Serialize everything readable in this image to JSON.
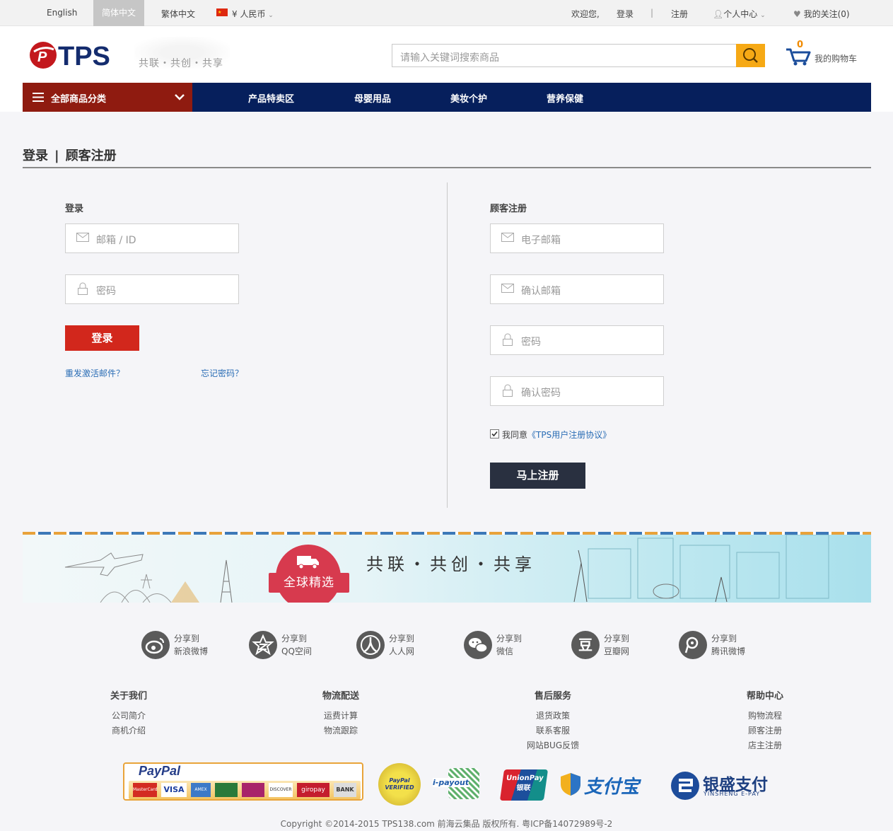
{
  "topbar": {
    "lang_en": "English",
    "lang_sc": "简体中文",
    "lang_tc": "繁体中文",
    "currency": "¥ 人民币",
    "welcome": "欢迎您,",
    "login": "登录",
    "divider": "|",
    "register": "注册",
    "account": "个人中心",
    "favorites": "我的关注(0)"
  },
  "header": {
    "logo": "TPS",
    "slogan": "共联・共创・共享",
    "search_placeholder": "请输入关键词搜索商品",
    "cart_count": "0",
    "cart_label": "我的购物车"
  },
  "nav": {
    "all_categories": "全部商品分类",
    "items": [
      "产品特卖区",
      "母婴用品",
      "美妆个护",
      "营养保健"
    ]
  },
  "page": {
    "title_login": "登录",
    "title_sep": "|",
    "title_register": "顾客注册"
  },
  "login": {
    "heading": "登录",
    "email_placeholder": "邮箱 / ID",
    "password_placeholder": "密码",
    "button": "登录",
    "resend": "重发激活邮件？",
    "forgot": "忘记密码？"
  },
  "register": {
    "heading": "顾客注册",
    "email_placeholder": "电子邮箱",
    "confirm_email_placeholder": "确认邮箱",
    "password_placeholder": "密码",
    "confirm_password_placeholder": "确认密码",
    "agree_prefix": "我同意",
    "agree_link": "《TPS用户注册协议》",
    "button": "马上注册"
  },
  "banner": {
    "badge": "全球精选",
    "slogan": "共联・共创・共享"
  },
  "share": [
    {
      "line1": "分享到",
      "line2": "新浪微博",
      "icon": "weibo-icon"
    },
    {
      "line1": "分享到",
      "line2": "QQ空间",
      "icon": "qzone-icon"
    },
    {
      "line1": "分享到",
      "line2": "人人网",
      "icon": "renren-icon"
    },
    {
      "line1": "分享到",
      "line2": "微信",
      "icon": "wechat-icon"
    },
    {
      "line1": "分享到",
      "line2": "豆瓣网",
      "icon": "douban-icon"
    },
    {
      "line1": "分享到",
      "line2": "腾讯微博",
      "icon": "tencent-weibo-icon"
    }
  ],
  "footer": {
    "cols": [
      {
        "title": "关于我们",
        "links": [
          "公司简介",
          "商机介绍"
        ]
      },
      {
        "title": "物流配送",
        "links": [
          "运费计算",
          "物流跟踪"
        ]
      },
      {
        "title": "售后服务",
        "links": [
          "退货政策",
          "联系客服",
          "网站BUG反馈"
        ]
      },
      {
        "title": "帮助中心",
        "links": [
          "购物流程",
          "顾客注册",
          "店主注册"
        ]
      }
    ],
    "paypal": "PayPal",
    "cards": [
      "MasterCard",
      "VISA",
      "AMEX",
      "",
      "",
      "DISCOVER",
      "giropay",
      "BANK"
    ],
    "paypal_verified": "PayPal VERIFIED",
    "ipayout": "i-payout",
    "unionpay": "UnionPay 银联",
    "alipay": "支付宝",
    "yinsheng": "银盛支付",
    "yinsheng_en": "YINSHENG E-PAY",
    "copyright": "Copyright ©2014-2015 TPS138.com 前海云集品 版权所有. 粤ICP备14072989号-2"
  },
  "colors": {
    "nav_bg": "#061f5c",
    "category_bg": "#8f1b10",
    "login_button": "#d2271c",
    "register_button": "#293040",
    "link": "#2a6db5"
  }
}
